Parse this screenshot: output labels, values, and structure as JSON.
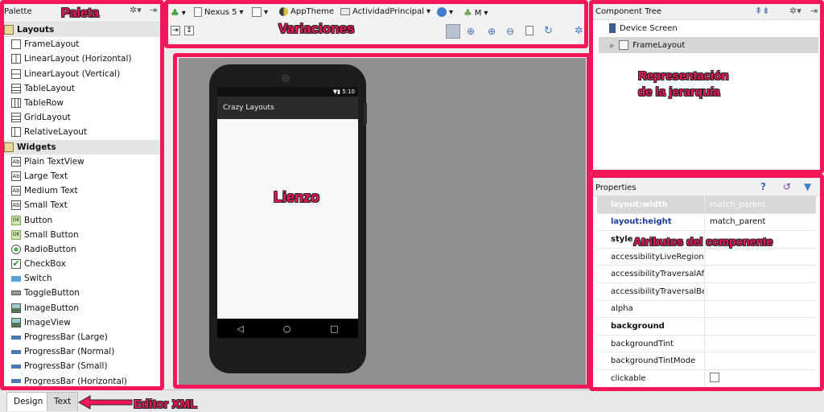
{
  "annotations": {
    "palette": "Paleta",
    "variations": "Variaciones",
    "canvas": "Lienzo",
    "hierarchy_line1": "Representación",
    "hierarchy_line2": "de la jerarquía",
    "attributes": "Atributos del componente",
    "xml_editor": "Editor XML",
    "highlight_color": "#f2175a"
  },
  "palette": {
    "title": "Palette",
    "groups": [
      {
        "label": "Layouts",
        "items": [
          "FrameLayout",
          "LinearLayout (Horizontal)",
          "LinearLayout (Vertical)",
          "TableLayout",
          "TableRow",
          "GridLayout",
          "RelativeLayout"
        ]
      },
      {
        "label": "Widgets",
        "items": [
          "Plain TextView",
          "Large Text",
          "Medium Text",
          "Small Text",
          "Button",
          "Small Button",
          "RadioButton",
          "CheckBox",
          "Switch",
          "ToggleButton",
          "ImageButton",
          "ImageView",
          "ProgressBar (Large)",
          "ProgressBar (Normal)",
          "ProgressBar (Small)",
          "ProgressBar (Horizontal)"
        ]
      }
    ]
  },
  "toolbar": {
    "device": "Nexus 5",
    "theme": "AppTheme",
    "activity": "ActividadPrincipal",
    "api": "M"
  },
  "phone": {
    "time": "5:10",
    "app_title": "Crazy Layouts"
  },
  "tree": {
    "title": "Component Tree",
    "root": "Device Screen",
    "child": "FrameLayout"
  },
  "properties": {
    "title": "Properties",
    "rows": [
      {
        "name": "layout:width",
        "value": "match_parent"
      },
      {
        "name": "layout:height",
        "value": "match_parent"
      },
      {
        "name": "style",
        "value": ""
      },
      {
        "name": "accessibilityLiveRegion",
        "value": ""
      },
      {
        "name": "accessibilityTraversalAfte",
        "value": ""
      },
      {
        "name": "accessibilityTraversalBefo",
        "value": ""
      },
      {
        "name": "alpha",
        "value": ""
      },
      {
        "name": "background",
        "value": ""
      },
      {
        "name": "backgroundTint",
        "value": ""
      },
      {
        "name": "backgroundTintMode",
        "value": ""
      },
      {
        "name": "clickable",
        "value": ""
      }
    ]
  },
  "tabs": [
    "Design",
    "Text"
  ]
}
